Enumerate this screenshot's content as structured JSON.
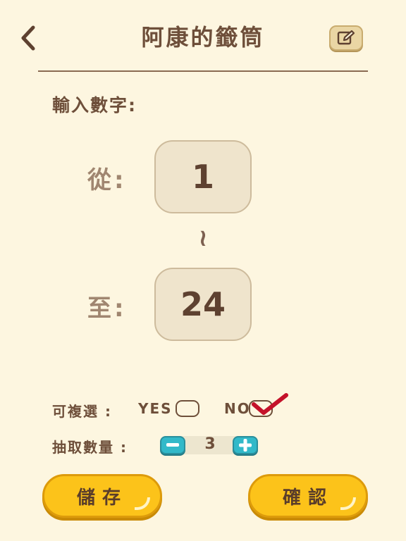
{
  "header": {
    "title": "阿康的籤筒",
    "back_icon": "chevron-left-icon",
    "edit_icon": "edit-icon"
  },
  "input": {
    "prompt": "輸入數字:",
    "from_label": "從:",
    "from_value": "1",
    "separator": "≀",
    "to_label": "至:",
    "to_value": "24"
  },
  "options": {
    "repeat_label": "可複選 :",
    "yes_label": "YES",
    "yes_checked": false,
    "no_label": "NO",
    "no_checked": true,
    "count_label": "抽取數量 :",
    "count_value": "3"
  },
  "buttons": {
    "save_label": "儲存",
    "confirm_label": "確認"
  },
  "colors": {
    "background": "#fdf6e0",
    "text": "#6e4f3a",
    "accent_yellow": "#fcc31a",
    "stepper_teal": "#32b9c9",
    "check_red": "#c4122a"
  }
}
